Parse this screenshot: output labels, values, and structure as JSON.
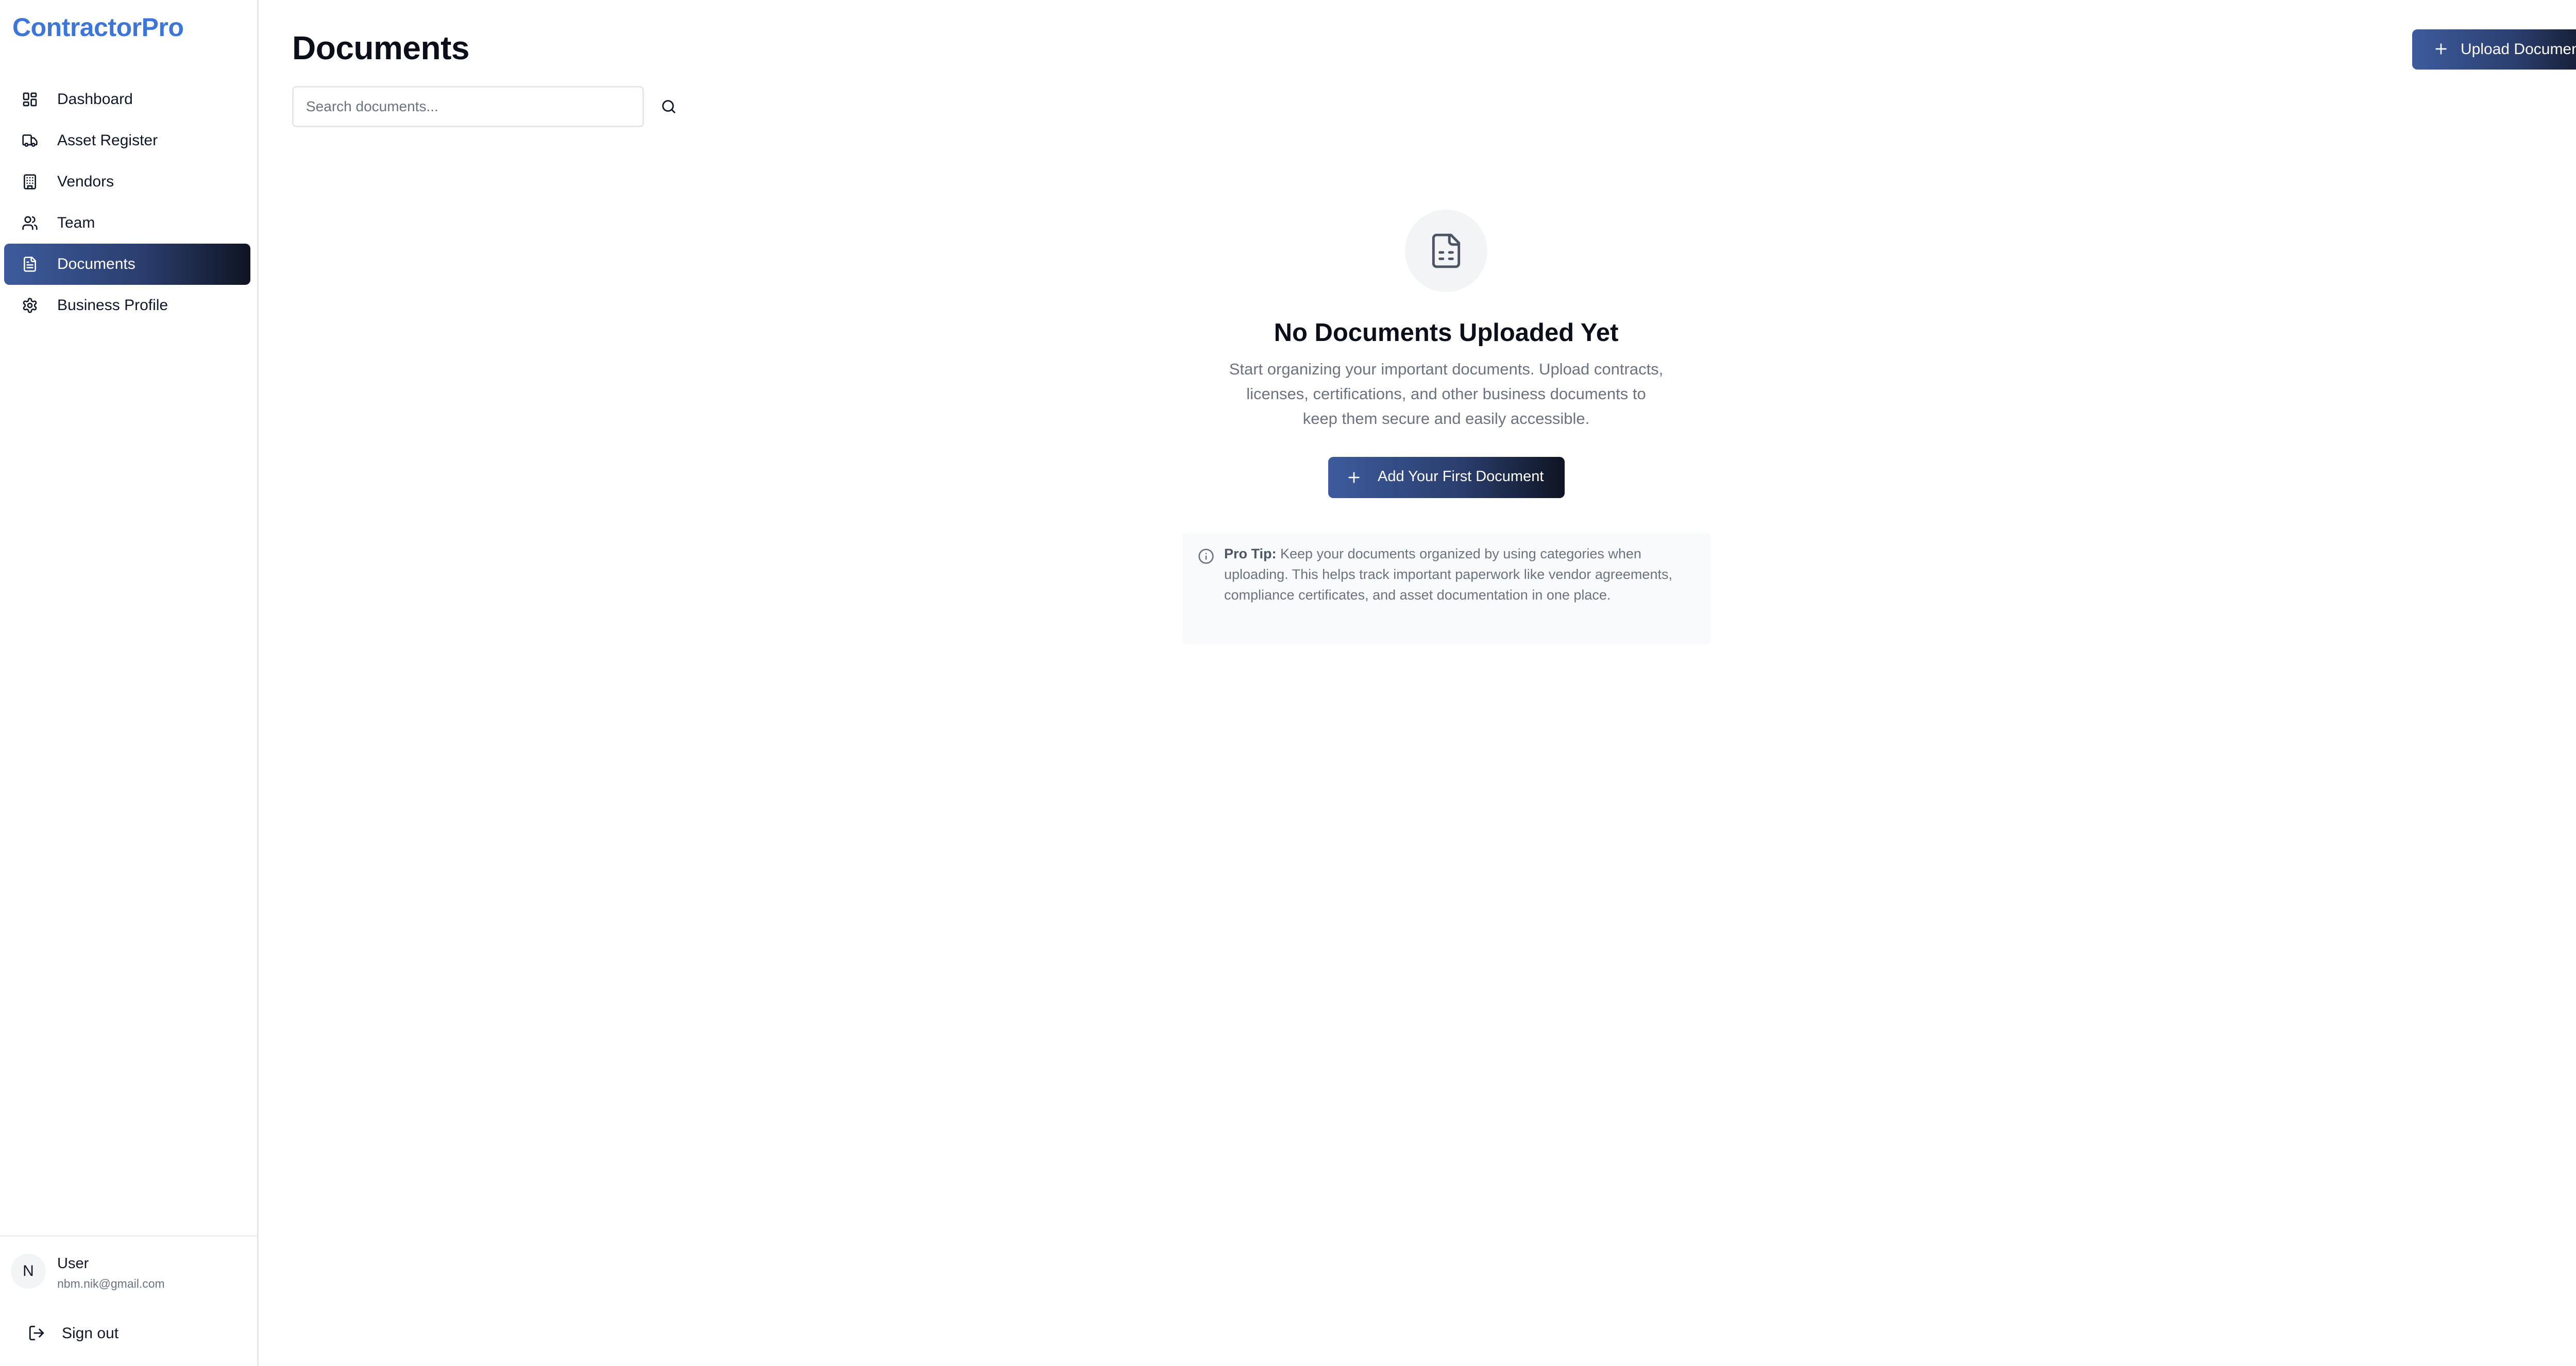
{
  "app": {
    "brand": "ContractorPro",
    "accent_color": "#3b76d8",
    "active_gradient": [
      "#3d5b9d",
      "#0f1423"
    ]
  },
  "sidebar": {
    "items": [
      {
        "label": "Dashboard",
        "icon": "dashboard-grid-icon",
        "active": false
      },
      {
        "label": "Asset Register",
        "icon": "truck-icon",
        "active": false
      },
      {
        "label": "Vendors",
        "icon": "building-icon",
        "active": false
      },
      {
        "label": "Team",
        "icon": "users-icon",
        "active": false
      },
      {
        "label": "Documents",
        "icon": "file-text-icon",
        "active": true
      },
      {
        "label": "Business Profile",
        "icon": "gear-icon",
        "active": false
      }
    ]
  },
  "user": {
    "initial": "N",
    "name": "User",
    "email": "nbm.nik@gmail.com",
    "signout_label": "Sign out"
  },
  "header": {
    "title": "Documents",
    "upload_label": "Upload Document"
  },
  "search": {
    "placeholder": "Search documents...",
    "value": ""
  },
  "empty_state": {
    "icon": "file-spreadsheet-icon",
    "title": "No Documents Uploaded Yet",
    "description": "Start organizing your important documents. Upload contracts, licenses, certifications, and other business documents to keep them secure and easily accessible.",
    "button_label": "Add Your First Document"
  },
  "tip": {
    "prefix": "Pro Tip:",
    "text": " Keep your documents organized by using categories when uploading. This helps track important paperwork like vendor agreements, compliance certificates, and asset documentation in one place."
  }
}
